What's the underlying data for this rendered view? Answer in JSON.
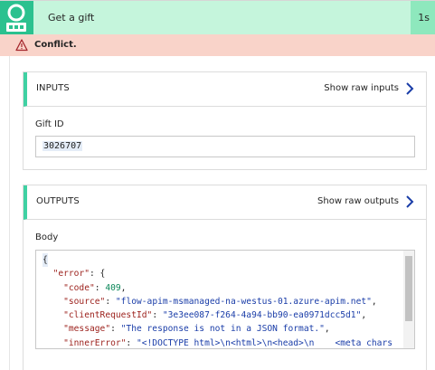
{
  "header": {
    "title": "Get a gift",
    "duration": "1s",
    "accent": "#2bc18f"
  },
  "alert": {
    "message": "Conflict."
  },
  "inputs": {
    "title": "INPUTS",
    "show_raw": "Show raw inputs",
    "field_label": "Gift ID",
    "field_value": "3026707"
  },
  "outputs": {
    "title": "OUTPUTS",
    "show_raw": "Show raw outputs",
    "field_label": "Body",
    "code": {
      "open_brace": "{",
      "error_key": "\"error\"",
      "code_key": "\"code\"",
      "code_value": "409",
      "source_key": "\"source\"",
      "source_value": "\"flow-apim-msmanaged-na-westus-01.azure-apim.net\"",
      "client_key": "\"clientRequestId\"",
      "client_value": "\"3e3ee087-f264-4a94-bb90-ea0971dcc5d1\"",
      "message_key": "\"message\"",
      "message_value": "\"The response is not in a JSON format.\"",
      "inner_key": "\"innerError\"",
      "inner_value": "\"<!DOCTYPE html>\\n<html>\\n<head>\\n    <meta chars"
    }
  }
}
